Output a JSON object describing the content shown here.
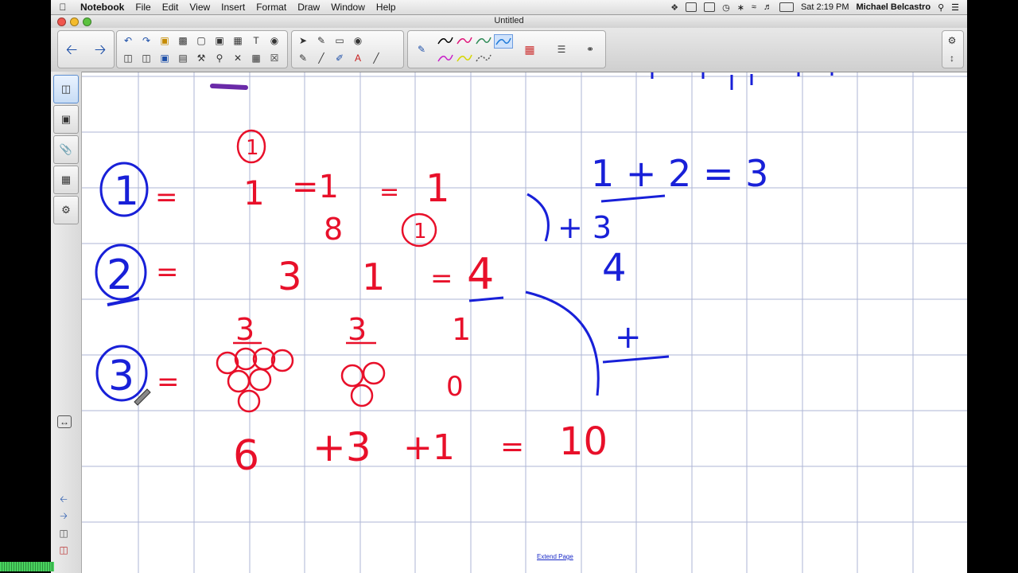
{
  "menubar": {
    "app": "Notebook",
    "menus": [
      "File",
      "Edit",
      "View",
      "Insert",
      "Format",
      "Draw",
      "Window",
      "Help"
    ],
    "clock": "Sat 2:19 PM",
    "user": "Michael Belcastro"
  },
  "window": {
    "title": "Untitled"
  },
  "toolbar": {
    "icons": [
      "back-arrow-icon",
      "forward-arrow-icon",
      "undo-icon",
      "redo-icon",
      "open-icon",
      "paste-icon",
      "screen-icon",
      "screen-capture-icon",
      "doc-camera-icon",
      "table-icon",
      "globe-icon",
      "select-arrow-icon",
      "pen-icon",
      "eraser-icon",
      "fill-icon",
      "line-icon",
      "shape-icon",
      "text-icon",
      "magic-pen-icon",
      "color-palette-icon",
      "properties-icon",
      "link-icon",
      "settings-gear-icon",
      "sort-arrows-icon"
    ],
    "pen_colors": [
      "#000000",
      "#e0157a",
      "#2e8b57",
      "#1f7ad8",
      "#c81fc8",
      "#d6d600",
      "#555555"
    ]
  },
  "sidebar": {
    "tabs": [
      "page-sorter-icon",
      "gallery-icon",
      "attachments-icon",
      "properties-icon",
      "addons-icon"
    ]
  },
  "canvas": {
    "ink_blue": "#1820d8",
    "ink_red": "#e8102a",
    "ink_purple": "#6a2aa8",
    "rows": [
      {
        "circled": "1",
        "eq": "=",
        "terms": [
          "1",
          "=1",
          "=",
          "1"
        ],
        "sub": [
          "8",
          "1"
        ]
      },
      {
        "circled": "2",
        "eq": "=",
        "terms": [
          "3",
          "1",
          "=",
          "4"
        ]
      },
      {
        "circled": "3",
        "eq": "=",
        "terms": [
          "3",
          "3",
          "1"
        ],
        "counts": [
          "0"
        ]
      }
    ],
    "blue_notes": [
      "1 + 2 = 3",
      "+ 3",
      "4",
      "+"
    ],
    "header_circled": "1",
    "total_line": [
      "6",
      "+3",
      "+1",
      "=",
      "10"
    ]
  },
  "footer": {
    "extend_page": "Extend Page"
  }
}
